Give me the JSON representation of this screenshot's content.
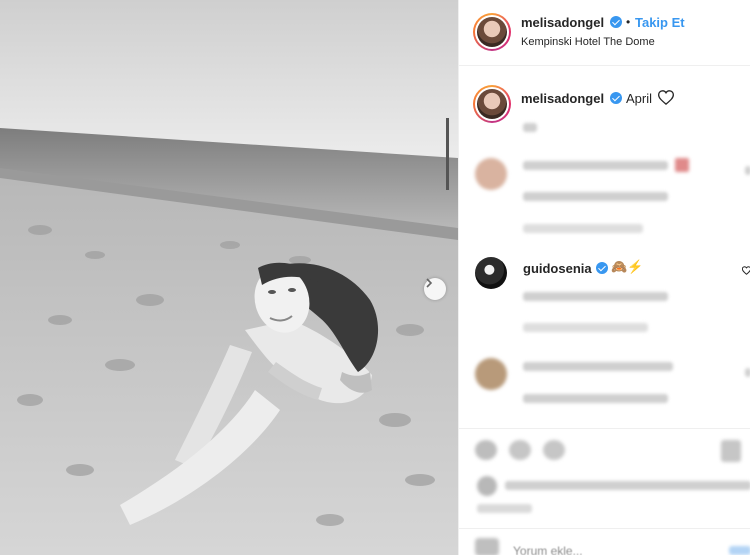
{
  "post": {
    "username": "melisadongel",
    "follow_separator": "•",
    "follow_label": "Takip Et",
    "location": "Kempinski Hotel The Dome",
    "caption_date": "April"
  },
  "comments": [
    {
      "username": "guidosenia",
      "emoji": "🙈⚡"
    }
  ],
  "footer": {
    "add_comment_placeholder": "Yorum ekle..."
  },
  "icons": {
    "next": "chevron-right-icon",
    "verified": "verified-badge-icon",
    "like": "heart-icon"
  },
  "colors": {
    "link_blue": "#3897f0",
    "text": "#262626",
    "divider": "#efefef"
  }
}
